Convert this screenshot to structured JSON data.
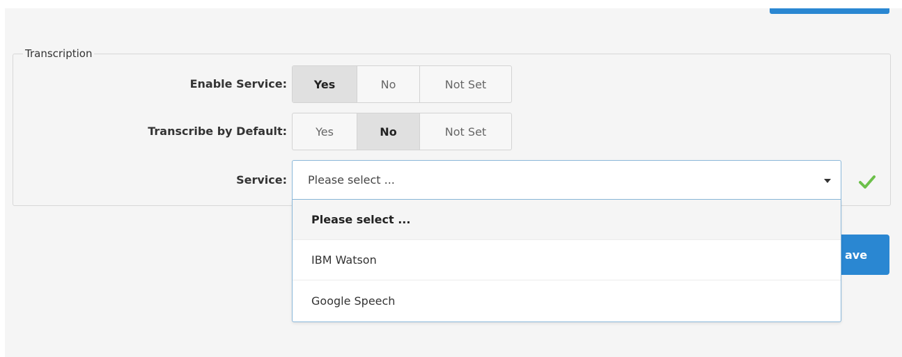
{
  "fieldset": {
    "legend": "Transcription"
  },
  "rows": {
    "enable_service": {
      "label": "Enable Service:",
      "options": [
        "Yes",
        "No",
        "Not Set"
      ],
      "selected": "Yes"
    },
    "transcribe_default": {
      "label": "Transcribe by Default:",
      "options": [
        "Yes",
        "No",
        "Not Set"
      ],
      "selected": "No"
    },
    "service": {
      "label": "Service:",
      "value": "Please select ..."
    }
  },
  "dropdown": {
    "options": [
      "Please select ...",
      "IBM Watson",
      "Google Speech"
    ],
    "selected": "Please select ..."
  },
  "save_button": {
    "label_visible": "ave"
  },
  "colors": {
    "accent": "#2a87d2",
    "check": "#6cc04a"
  },
  "icons": {
    "select_caret": "caret-down-icon",
    "valid": "checkmark-icon"
  }
}
